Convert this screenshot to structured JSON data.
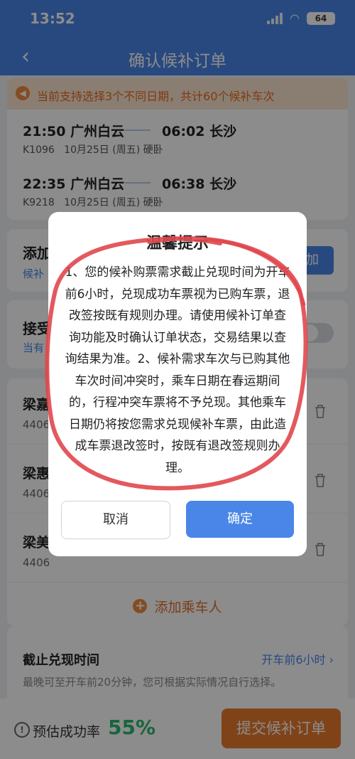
{
  "status_bar": {
    "time": "13:52",
    "battery": "64"
  },
  "nav": {
    "title": "确认候补订单"
  },
  "notice": {
    "text": "当前支持选择3个不同日期，共计60个候补车次"
  },
  "trains": [
    {
      "dep_time": "21:50",
      "dep_station": "广州白云",
      "arr_time": "06:02",
      "arr_station": "长沙",
      "train_no": "K1096",
      "date": "10月25日 (周五)",
      "seat": "硬卧"
    },
    {
      "dep_time": "22:35",
      "dep_station": "广州白云",
      "arr_time": "06:38",
      "arr_station": "长沙",
      "train_no": "K9218",
      "date": "10月25日 (周五)",
      "seat": "硬卧"
    }
  ],
  "add_ticket": {
    "title": "添加",
    "sub": "候补",
    "button": "加"
  },
  "accept": {
    "title": "接受",
    "sub": "当有"
  },
  "passengers": [
    {
      "name": "梁嘉",
      "id": "4406"
    },
    {
      "name": "梁惠",
      "id": "4406"
    },
    {
      "name": "梁美",
      "id": "4406"
    }
  ],
  "add_passenger": {
    "label": "添加乘车人"
  },
  "deadline": {
    "title": "截止兑现时间",
    "link": "开车前6小时 ›",
    "sub": "最晚可至开车前20分钟，您可根据实际情况自行选择。"
  },
  "footer": {
    "rate_label": "预估成功率",
    "rate_value": "55%",
    "submit": "提交候补订单"
  },
  "modal": {
    "title": "温馨提示",
    "body": "1、您的候补购票需求截止兑现时间为开车前6小时，兑现成功车票视为已购车票，退改签按既有规则办理。请使用候补订单查询功能及时确认订单状态，交易结果以查询结果为准。2、候补需求车次与已购其他车次时间冲突时，乘车日期在春运期间的，行程冲突车票将不予兑现。其他乘车日期仍将按您需求兑现候补车票，由此造成车票退改签时，按既有退改签规则办理。",
    "cancel": "取消",
    "confirm": "确定"
  },
  "colors": {
    "primary": "#4a86e8",
    "accent": "#e97b2c",
    "success": "#2db871",
    "annotation": "#e0474c"
  }
}
